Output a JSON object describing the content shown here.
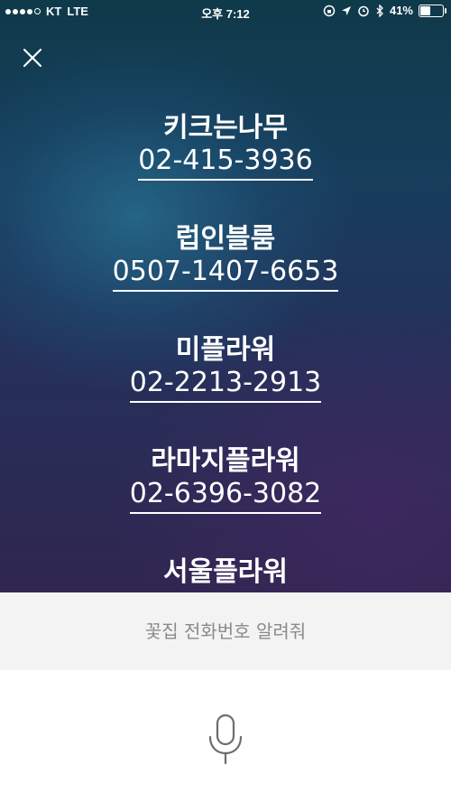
{
  "status_bar": {
    "carrier": "KT",
    "network": "LTE",
    "time": "오후 7:12",
    "battery": "41%",
    "battery_level": 0.41
  },
  "results": [
    {
      "name": "키크는나무",
      "phone": "02-415-3936"
    },
    {
      "name": "럽인블룸",
      "phone": "0507-1407-6653"
    },
    {
      "name": "미플라워",
      "phone": "02-2213-2913"
    },
    {
      "name": "라마지플라워",
      "phone": "02-6396-3082"
    },
    {
      "name": "서울플라워",
      "phone": ""
    }
  ],
  "query": {
    "text": "꽃집 전화번호 알려줘"
  },
  "icons": {
    "close": "close-icon",
    "mic": "microphone-icon"
  }
}
